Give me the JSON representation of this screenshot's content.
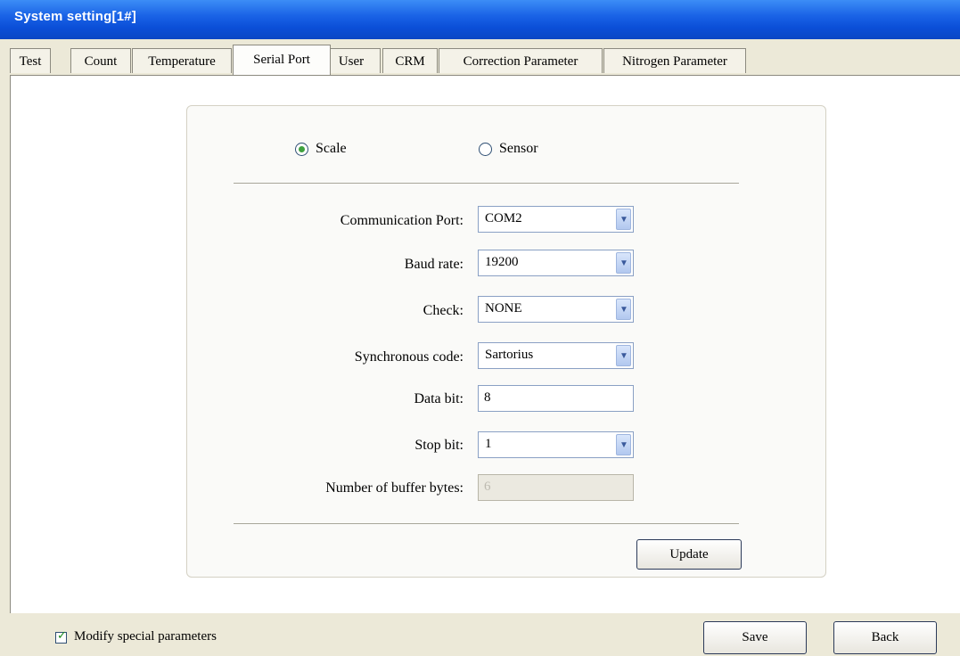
{
  "window": {
    "title": "System setting[1#]"
  },
  "tabs": [
    {
      "label": "Test"
    },
    {
      "label": "Count"
    },
    {
      "label": "Temperature"
    },
    {
      "label": "Serial Port",
      "active": true
    },
    {
      "label": "User"
    },
    {
      "label": "CRM"
    },
    {
      "label": "Correction Parameter"
    },
    {
      "label": "Nitrogen Parameter"
    }
  ],
  "device_select": {
    "options": [
      {
        "label": "Scale",
        "checked": true
      },
      {
        "label": "Sensor",
        "checked": false
      }
    ]
  },
  "fields": {
    "communication_port": {
      "label": "Communication Port:",
      "value": "COM2"
    },
    "baud_rate": {
      "label": "Baud rate:",
      "value": "19200"
    },
    "check": {
      "label": "Check:",
      "value": "NONE"
    },
    "synchronous_code": {
      "label": "Synchronous code:",
      "value": "Sartorius"
    },
    "data_bit": {
      "label": "Data bit:",
      "value": "8"
    },
    "stop_bit": {
      "label": "Stop bit:",
      "value": "1"
    },
    "buffer_bytes": {
      "label": "Number of buffer bytes:",
      "value": "6"
    }
  },
  "buttons": {
    "update": "Update",
    "save": "Save",
    "back": "Back"
  },
  "footer": {
    "modify_special_label": "Modify special parameters",
    "modify_special_checked": true
  },
  "icons": {
    "dropdown": "chevron-down-icon",
    "check": "checkmark-icon"
  },
  "colors": {
    "titlebar": "#0b4fd8",
    "radio_dot": "#3fa13f",
    "check_mark": "#1a8a1a"
  }
}
